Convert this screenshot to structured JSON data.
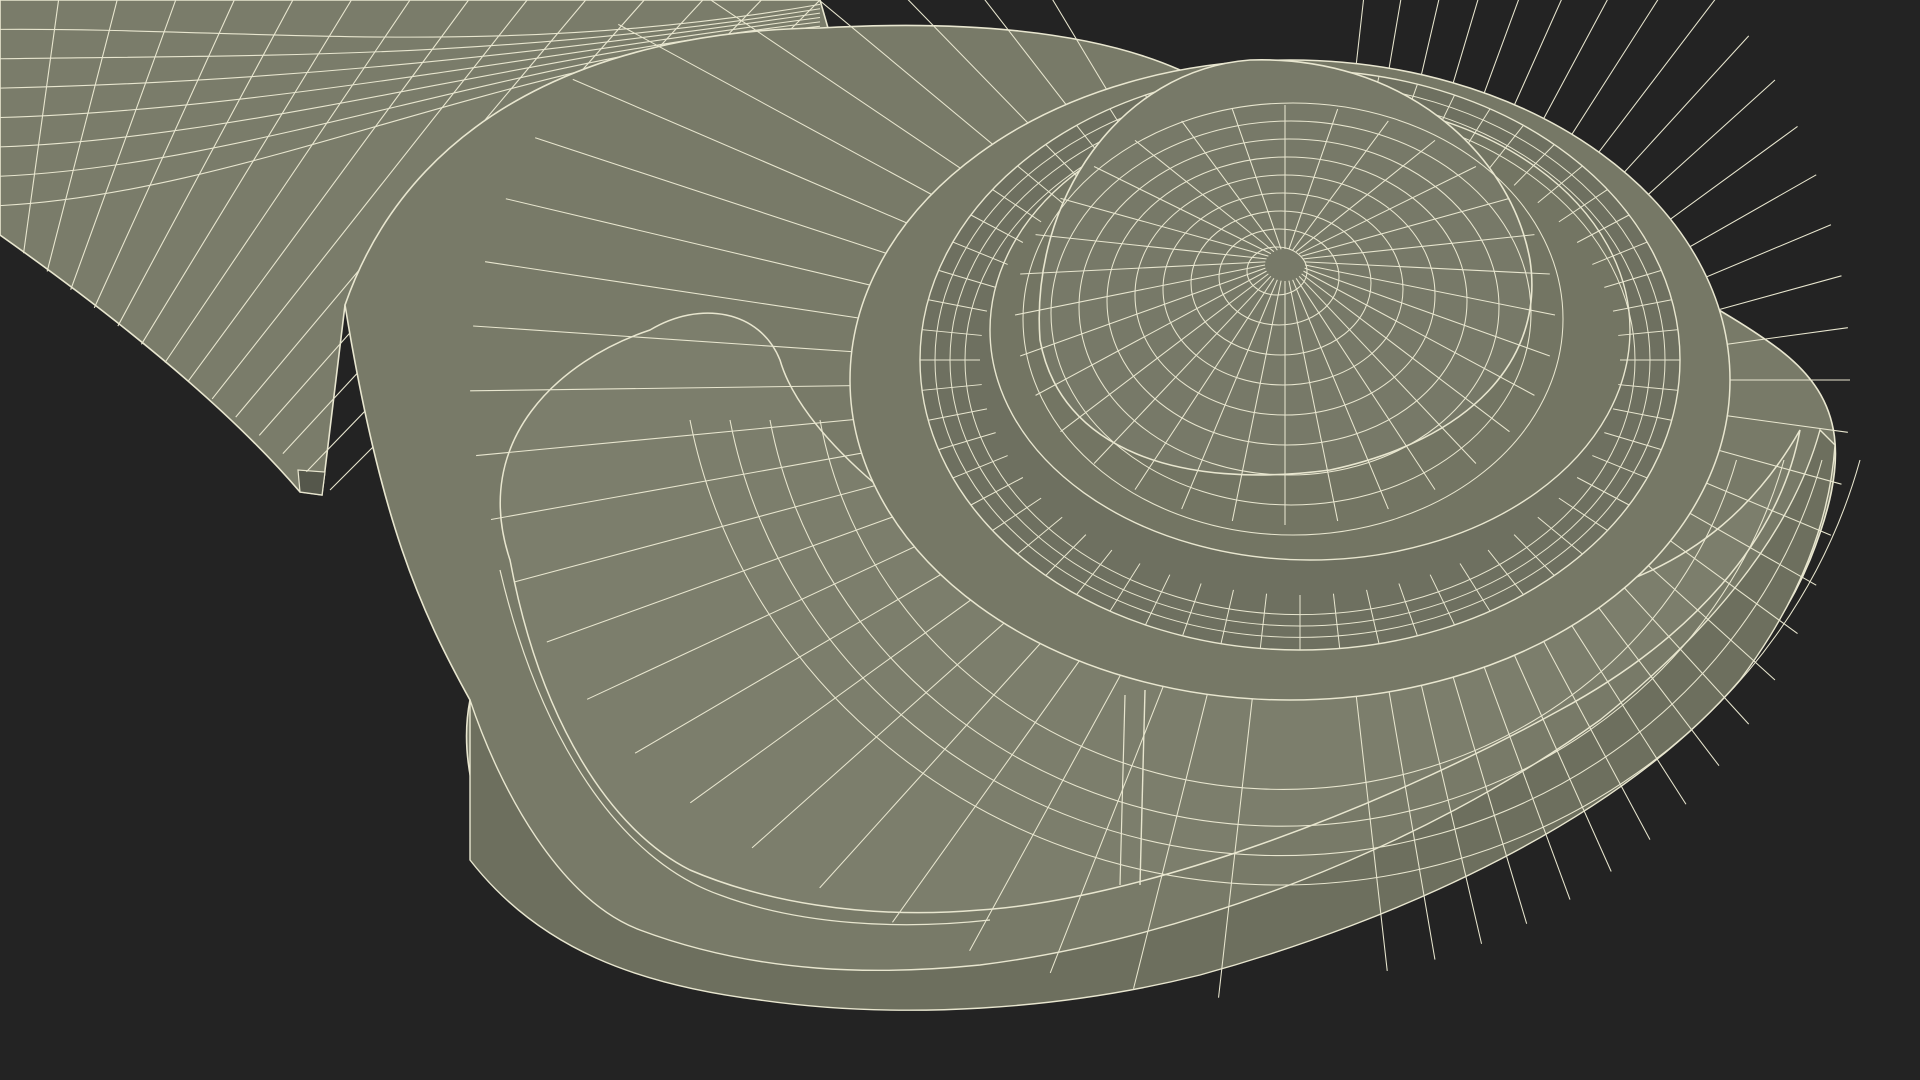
{
  "scene": {
    "background_color": "#232323",
    "surface_color": "#787a68",
    "surface_shadow_color": "#5f6154",
    "wire_color": "#e8e6cf"
  }
}
